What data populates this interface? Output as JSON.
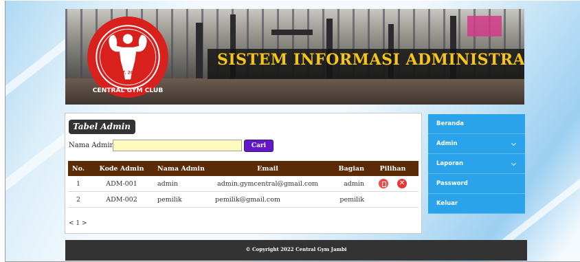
{
  "header": {
    "title": "SISTEM INFORMASI ADMINISTRASI",
    "logo": {
      "top_text": "EST. 2017",
      "bottom_text": "CENTRAL GYM CLUB",
      "colors": {
        "red": "#d8211d",
        "white": "#ffffff"
      }
    }
  },
  "content": {
    "heading": "Tabel Admin",
    "search": {
      "label": "Nama Admin :",
      "value": "",
      "placeholder": "",
      "button_label": "Cari"
    },
    "table": {
      "columns": [
        "No.",
        "Kode Admin",
        "Nama Admin",
        "Email",
        "Bagian",
        "Pilihan"
      ],
      "rows": [
        {
          "no": "1",
          "kode": "ADM-001",
          "nama": "admin",
          "email": "admin.gymcentral@gmail.com",
          "bagian": "admin",
          "actions": [
            "edit-icon",
            "delete-icon"
          ]
        },
        {
          "no": "2",
          "kode": "ADM-002",
          "nama": "pemilik",
          "email": "pemilik@gmail.com",
          "bagian": "pemilik",
          "actions": []
        }
      ]
    },
    "pagination": "< 1 >"
  },
  "sidebar": {
    "items": [
      {
        "label": "Beranda",
        "has_submenu": false
      },
      {
        "label": "Admin",
        "has_submenu": true
      },
      {
        "label": "Laporan",
        "has_submenu": true
      },
      {
        "label": "Password",
        "has_submenu": false
      },
      {
        "label": "Keluar",
        "has_submenu": false
      }
    ]
  },
  "footer": {
    "text": "© Copyright 2022 Central Gym Jambi"
  },
  "colors": {
    "header_title": "#f6c41b",
    "table_header": "#5b2a06",
    "search_button": "#6219c4",
    "search_input_bg": "#fffbbf",
    "sidebar": "#2aa3ea",
    "footer": "#333333"
  }
}
